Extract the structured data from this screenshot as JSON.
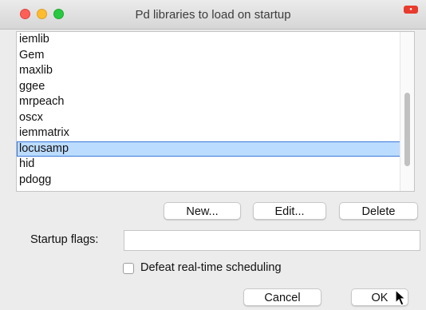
{
  "window": {
    "title": "Pd libraries to load on startup"
  },
  "libraries": {
    "items": [
      "iemlib",
      "Gem",
      "maxlib",
      "ggee",
      "mrpeach",
      "oscx",
      "iemmatrix",
      "locusamp",
      "hid",
      "pdogg"
    ],
    "selected": "locusamp"
  },
  "buttons": {
    "new": "New...",
    "edit": "Edit...",
    "delete": "Delete",
    "cancel": "Cancel",
    "ok": "OK"
  },
  "startup_flags": {
    "label": "Startup flags:",
    "value": ""
  },
  "realtime": {
    "label": "Defeat real-time scheduling",
    "checked": false
  },
  "colors": {
    "selection": "#bcdcff",
    "selection_border": "#3b78d8"
  }
}
